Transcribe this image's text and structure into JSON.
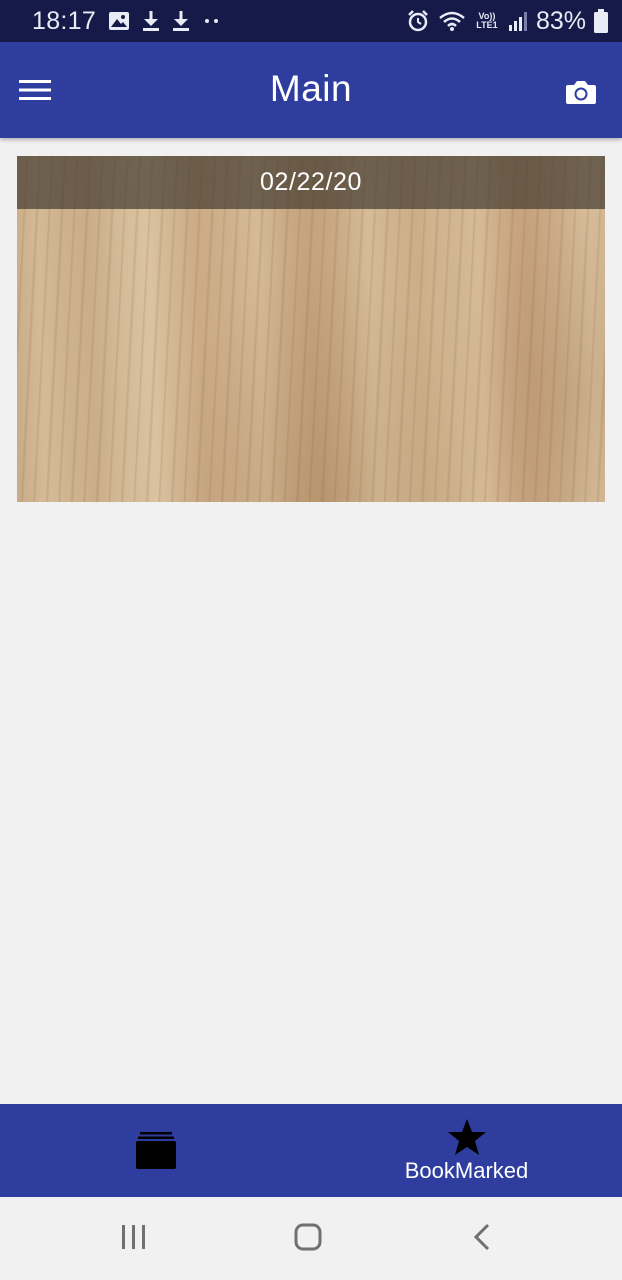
{
  "status_bar": {
    "time": "18:17",
    "battery_percent": "83%",
    "network_label": "Vo)) LTE1"
  },
  "app_bar": {
    "title": "Main",
    "menu_icon": "hamburger-menu-icon",
    "camera_icon": "camera-icon"
  },
  "cards": [
    {
      "date": "02/22/20",
      "image": "wood-texture-photo"
    }
  ],
  "bottom_nav": {
    "tabs": [
      {
        "icon": "stacked-cards-icon",
        "label": ""
      },
      {
        "icon": "star-icon",
        "label": "BookMarked"
      }
    ]
  },
  "colors": {
    "status_bar": "#151a48",
    "primary": "#2f3d9e",
    "background": "#f1f1f1"
  }
}
